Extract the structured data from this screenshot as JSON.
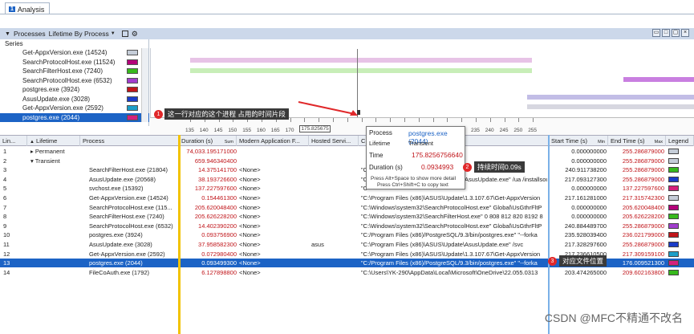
{
  "window": {
    "tab_number": "1",
    "tab_label": "Analysis"
  },
  "toolbar": {
    "processes_label": "Processes",
    "preset_label": "Lifetime By Process"
  },
  "series_pane": {
    "header": "Series",
    "items": [
      {
        "label": "Get-AppxVersion.exe (14524)",
        "color": "#c5cdd8"
      },
      {
        "label": "SearchProtocolHost.exe (11524)",
        "color": "#b4007a"
      },
      {
        "label": "SearchFilterHost.exe (7240)",
        "color": "#37b91c"
      },
      {
        "label": "SearchProtocolHost.exe (6532)",
        "color": "#a13dcd"
      },
      {
        "label": "postgres.exe (3924)",
        "color": "#c0151a"
      },
      {
        "label": "AsusUpdate.exe (3028)",
        "color": "#1b3cc8"
      },
      {
        "label": "Get-AppxVersion.exe (2592)",
        "color": "#1c9ec8"
      },
      {
        "label": "postgres.exe (2044)",
        "color": "#d4207c"
      }
    ]
  },
  "axis": {
    "ticks": [
      "135",
      "140",
      "145",
      "150",
      "155",
      "160",
      "165",
      "170",
      "175.825675",
      "",
      "",
      "",
      "",
      "",
      "205",
      "210",
      "215",
      "220",
      "225",
      "230",
      "235",
      "240",
      "245",
      "250",
      "255"
    ]
  },
  "tooltip": {
    "process_label": "Process",
    "process_value": "postgres.exe (2044)",
    "lifetime_label": "Lifetime",
    "lifetime_value": "Transient",
    "time_label": "Time",
    "time_value": "175.8256756640",
    "duration_label": "Duration (s)",
    "duration_value": "0.0934993",
    "hint1": "Press Alt+Space to show more detail",
    "hint2": "Press Ctrl+Shift+C to copy text"
  },
  "annotations": {
    "a1_number": "1",
    "a1_text": "这一行对应的这个进程 占用的时间片段",
    "a2_number": "2",
    "a2_text": "持续时间0.09s",
    "a3_number": "3",
    "a3_text": "对应文件位置"
  },
  "grid": {
    "headers": {
      "line": "Lin...",
      "lifetime": "Lifetime",
      "process": "Process",
      "duration": "Duration (s)",
      "duration_sub": "Sum",
      "modern_app": "Modern Application F...",
      "hosted": "Hosted Servi...",
      "cmd": "C",
      "start": "Start Time (s)",
      "start_sub": "Min",
      "end": "End Time (s)",
      "end_sub": "Max",
      "legend": "Legend"
    },
    "rows": [
      {
        "line": "1",
        "lifetime": "Permanent",
        "process": "",
        "duration": "74,033.195171000",
        "modern": "",
        "hosted": "",
        "cmd": "",
        "start": "0.000000000",
        "end": "255.286879000",
        "legend": "#c5cdd8"
      },
      {
        "line": "2",
        "lifetime": "Transient",
        "process": "",
        "duration": "659.946340400",
        "modern": "",
        "hosted": "",
        "cmd": "",
        "start": "0.000000000",
        "end": "255.286879000",
        "legend": "#c5cdd8"
      },
      {
        "line": "3",
        "lifetime": "",
        "process": "SearchFilterHost.exe (21804)",
        "duration": "14.375141700",
        "modern": "<None>",
        "hosted": "",
        "cmd": "\"C",
        "start": "240.911738200",
        "end": "255.286879000",
        "legend": "#37b91c"
      },
      {
        "line": "4",
        "lifetime": "",
        "process": "AsusUpdate.exe (20568)",
        "duration": "38.193726600",
        "modern": "<None>",
        "hosted": "",
        "cmd": "\"C:\\Program Files (x86)\\ASUS\\Update\\AsusUpdate.exe\" /ua /installsource",
        "start": "217.093127300",
        "end": "255.286879000",
        "legend": "#1b3cc8"
      },
      {
        "line": "5",
        "lifetime": "",
        "process": "svchost.exe (15392)",
        "duration": "137.227597600",
        "modern": "<None>",
        "hosted": "",
        "cmd": "\"C",
        "start": "0.000000000",
        "end": "137.227597600",
        "legend": "#d4207c"
      },
      {
        "line": "6",
        "lifetime": "",
        "process": "Get-AppxVersion.exe (14524)",
        "duration": "0.154461300",
        "modern": "<None>",
        "hosted": "",
        "cmd": "\"C:\\Program Files (x86)\\ASUS\\Update\\1.3.107.67\\Get-AppxVersion",
        "start": "217.161281000",
        "end": "217.315742300",
        "legend": "#c5cdd8"
      },
      {
        "line": "7",
        "lifetime": "",
        "process": "SearchProtocolHost.exe (115...",
        "duration": "205.620048400",
        "modern": "<None>",
        "hosted": "",
        "cmd": "\"C:\\Windows\\system32\\SearchProtocolHost.exe\" Global\\UsGthrFltP",
        "start": "0.000000000",
        "end": "205.620048400",
        "legend": "#b4007a"
      },
      {
        "line": "8",
        "lifetime": "",
        "process": "SearchFilterHost.exe (7240)",
        "duration": "205.626228200",
        "modern": "<None>",
        "hosted": "",
        "cmd": "\"C:\\Windows\\system32\\SearchFilterHost.exe\" 0 808 812 820 8192 8",
        "start": "0.000000000",
        "end": "205.626228200",
        "legend": "#37b91c"
      },
      {
        "line": "9",
        "lifetime": "",
        "process": "SearchProtocolHost.exe (6532)",
        "duration": "14.402390200",
        "modern": "<None>",
        "hosted": "",
        "cmd": "\"C:\\Windows\\system32\\SearchProtocolHost.exe\" Global\\UsGthrFltP",
        "start": "240.884489700",
        "end": "255.286879000",
        "legend": "#a13dcd"
      },
      {
        "line": "10",
        "lifetime": "",
        "process": "postgres.exe (3924)",
        "duration": "0.093756900",
        "modern": "<None>",
        "hosted": "",
        "cmd": "\"C:/Program Files (x86)/PostgreSQL/9.3/bin/postgres.exe\" \"--forka",
        "start": "235.928039400",
        "end": "236.021799000",
        "legend": "#c0151a"
      },
      {
        "line": "11",
        "lifetime": "",
        "process": "AsusUpdate.exe (3028)",
        "duration": "37.958582300",
        "modern": "<None>",
        "hosted": "asus",
        "cmd": "\"C:\\Program Files (x86)\\ASUS\\Update\\AsusUpdate.exe\" /svc",
        "start": "217.328297600",
        "end": "255.286879000",
        "legend": "#1b3cc8"
      },
      {
        "line": "12",
        "lifetime": "",
        "process": "Get-AppxVersion.exe (2592)",
        "duration": "0.072980400",
        "modern": "<None>",
        "hosted": "",
        "cmd": "\"C:\\Program Files (x86)\\ASUS\\Update\\1.3.107.67\\Get-AppxVersion",
        "start": "217.236610500",
        "end": "217.309159100",
        "legend": "#1c9ec8"
      },
      {
        "line": "13",
        "lifetime": "",
        "process": "postgres.exe (2044)",
        "duration": "0.093499300",
        "modern": "<None>",
        "hosted": "",
        "cmd": "\"C:/Program Files (x86)/PostgreSQL/9.3/bin/postgres.exe\" \"--forka",
        "start": "175.825675600",
        "end": "176.009521300",
        "legend": "#d4207c"
      },
      {
        "line": "14",
        "lifetime": "",
        "process": "FileCoAuth.exe (1792)",
        "duration": "6.127898800",
        "modern": "<None>",
        "hosted": "",
        "cmd": "\"C:\\Users\\YK-290\\AppData\\Local\\Microsoft\\OneDrive\\22.055.0313",
        "start": "203.474265000",
        "end": "209.602163800",
        "legend": "#37b91c"
      }
    ]
  },
  "watermark": "CSDN @MFC不精通不改名"
}
